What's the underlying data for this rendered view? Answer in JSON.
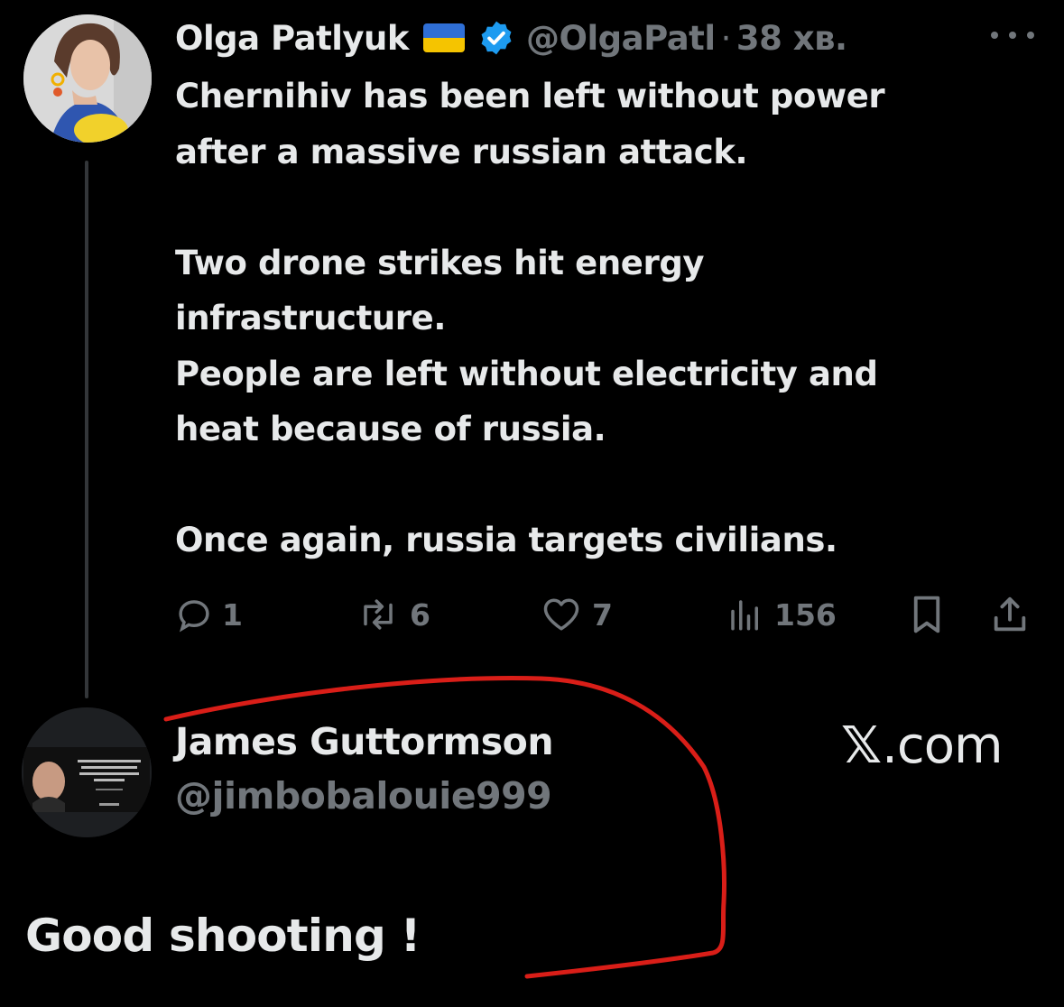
{
  "tweet": {
    "author_name": "Olga Patlyuk",
    "flag_icon": "ukraine-flag-icon",
    "verified_icon": "verified-badge-icon",
    "handle": "@OlgaPatl",
    "separator": "·",
    "time": "38 хв.",
    "more_icon": "more-dots-icon",
    "text_lines": [
      "Chernihiv has been left without power",
      "after a massive russian attack.",
      "",
      "Two drone strikes hit energy",
      "infrastructure.",
      "People are left without electricity and",
      "heat because of russia.",
      "",
      "Once again, russia targets civilians."
    ],
    "actions": {
      "replies": "1",
      "reposts": "6",
      "likes": "7",
      "views": "156"
    }
  },
  "reply": {
    "author_name": "James Guttormson",
    "handle": "@jimbobalouie999",
    "text": "Good shooting !"
  },
  "watermark": {
    "x_mark": "𝕏",
    "domain": ".com"
  },
  "colors": {
    "background": "#000000",
    "text_primary": "#e7e9ea",
    "text_secondary": "#71767b",
    "verified_blue": "#1d9bf0",
    "annotation_red": "#d91e18",
    "flag_blue": "#2f6fd6",
    "flag_yellow": "#f5c400"
  }
}
